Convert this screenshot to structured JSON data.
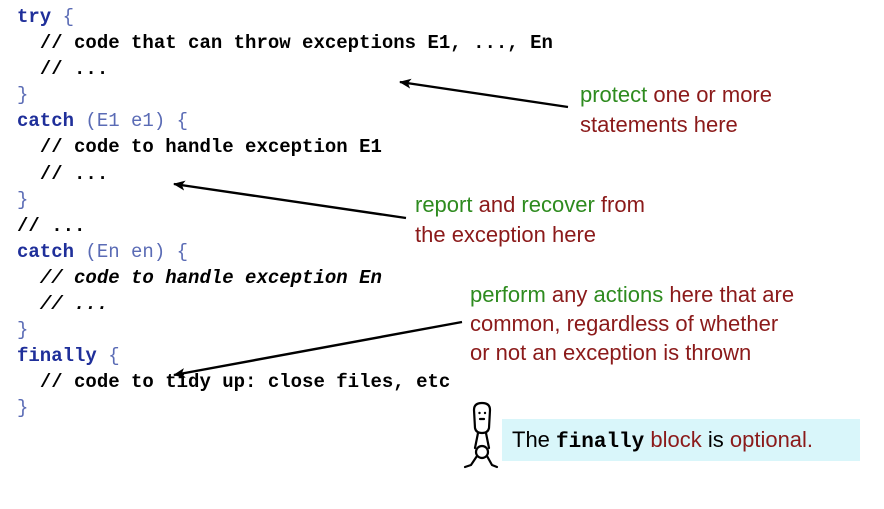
{
  "code": {
    "try_kw": "try",
    "open_brace": "{",
    "close_brace": "}",
    "try_comment1": "// code that can throw exceptions E1, ..., En",
    "try_comment2": "// ...",
    "catch_kw": "catch",
    "catch1_params": "(E1 e1)",
    "catch1_comment1": "// code to handle exception E1",
    "catch1_comment2": "// ...",
    "between_comment": "// ...",
    "catch2_params": "(En en)",
    "catch2_comment1": "// code to handle exception En",
    "catch2_comment2": "// ...",
    "finally_kw": "finally",
    "finally_comment": "// code to tidy up: close files, etc"
  },
  "notes": {
    "protect": {
      "w1": "protect",
      "w2": " one or more",
      "line2": "statements here"
    },
    "report": {
      "w1": "report",
      "w2": " and ",
      "w3": "recover",
      "w4": " from",
      "line2": "the exception here"
    },
    "perform": {
      "w1": "perform",
      "w2": " any ",
      "w3": "actions",
      "w4": " here that are",
      "line2": "common, regardless of whether",
      "line3": "or not an exception is thrown"
    }
  },
  "callout": {
    "pre": "The ",
    "keyword": "finally",
    "mid1": " block",
    "mid2": " is ",
    "end": "optional."
  },
  "colors": {
    "keyword": "#1f2f9a",
    "green": "#2e8b1f",
    "darkred": "#8b1a1a",
    "callout_bg": "#d9f6fa"
  },
  "icons": {
    "figure": "stick-figure-icon"
  }
}
